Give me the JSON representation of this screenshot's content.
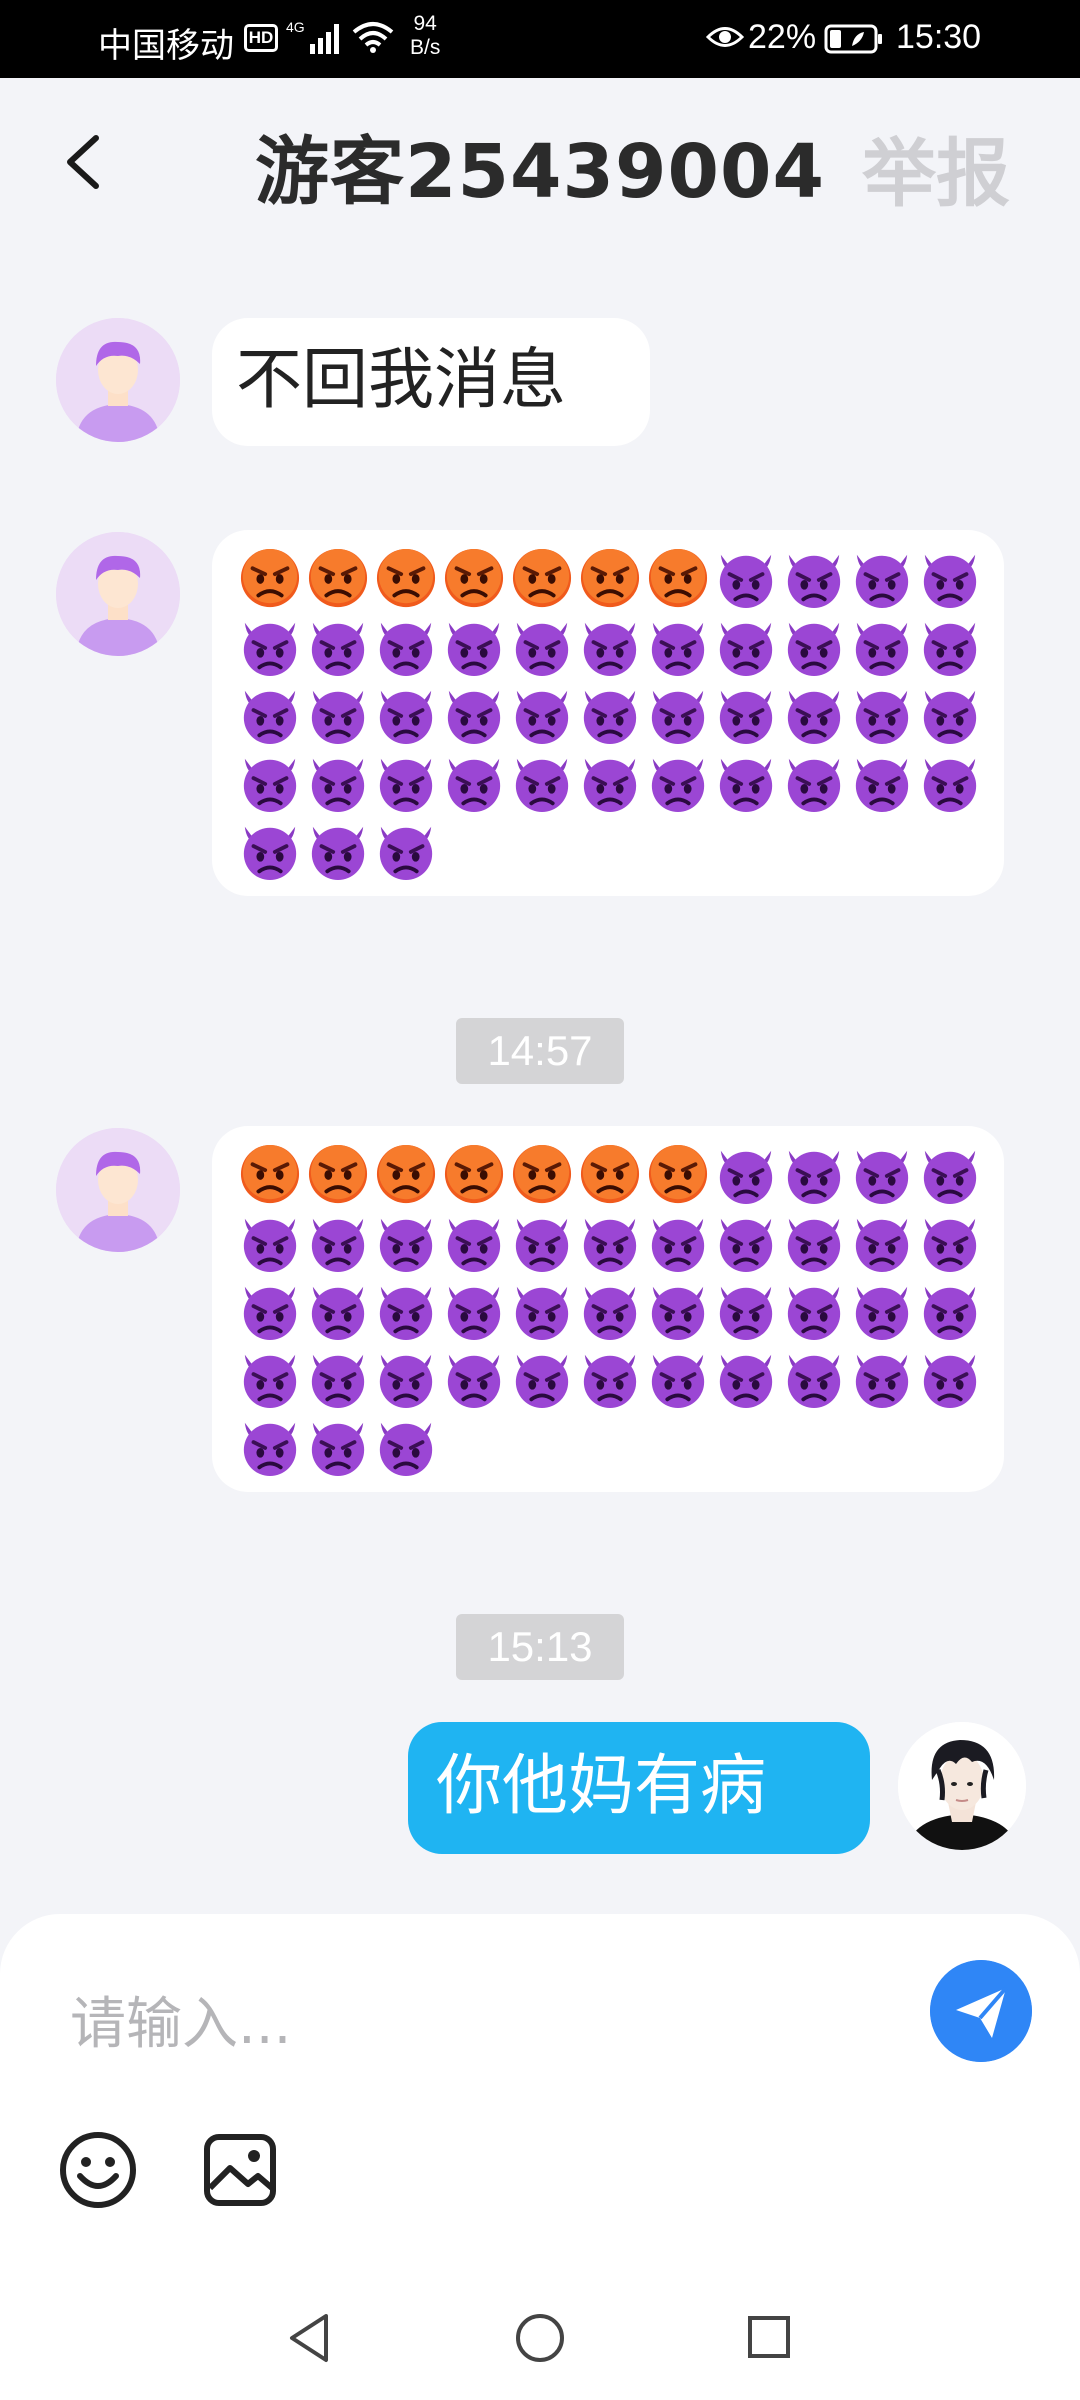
{
  "status_bar": {
    "carrier": "中国移动",
    "hd": "HD",
    "network": "4G",
    "speed_value": "94",
    "speed_unit": "B/s",
    "battery": "22%",
    "time": "15:30"
  },
  "header": {
    "title": "游客25439004",
    "report_label": "举报",
    "back_icon": "chevron-left-icon"
  },
  "messages": [
    {
      "side": "left",
      "type": "text",
      "text": "不回我消息"
    },
    {
      "side": "left",
      "type": "emoji",
      "angry_count": 7,
      "devil_count": 40
    },
    {
      "type": "timestamp",
      "text": "14:57"
    },
    {
      "side": "left",
      "type": "emoji",
      "angry_count": 7,
      "devil_count": 40
    },
    {
      "type": "timestamp",
      "text": "15:13"
    },
    {
      "side": "right",
      "type": "text",
      "text": "你他妈有病"
    }
  ],
  "input": {
    "placeholder": "请输入...",
    "value": "",
    "send_icon": "paper-plane-icon",
    "emoji_icon": "smiley-icon",
    "image_icon": "image-icon"
  },
  "colors": {
    "background": "#f3f4f8",
    "my_bubble": "#1fb4f2",
    "send_button": "#2f86f6",
    "avatar_bg": "#ecdcf6",
    "avatar_hair": "#b067e8",
    "timestamp_bg": "#d4d4d6"
  }
}
